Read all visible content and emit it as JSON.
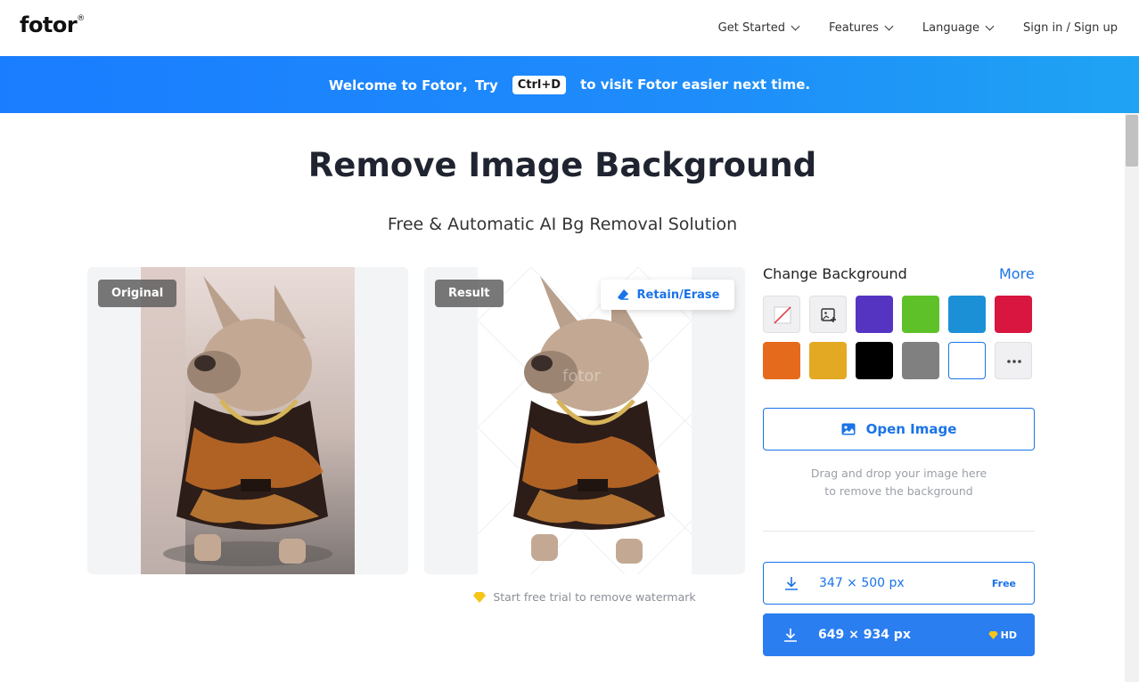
{
  "header": {
    "logo": "fotor",
    "logo_mark": "®",
    "nav": [
      {
        "label": "Get Started"
      },
      {
        "label": "Features"
      },
      {
        "label": "Language"
      }
    ],
    "auth_label": "Sign in / Sign up"
  },
  "banner": {
    "text_before": "Welcome to Fotor，Try",
    "shortcut": "Ctrl+D",
    "text_after": "to visit Fotor easier next time."
  },
  "page": {
    "title": "Remove Image Background",
    "subtitle": "Free & Automatic AI Bg Removal Solution"
  },
  "preview": {
    "original_tag": "Original",
    "result_tag": "Result",
    "retain_erase_label": "Retain/Erase",
    "watermark_note": "Start free trial to remove watermark"
  },
  "change_background": {
    "title": "Change Background",
    "more_label": "More",
    "swatches": [
      {
        "name": "none",
        "color": "#f0f0f2",
        "icon": "no-color-icon"
      },
      {
        "name": "custom-image",
        "color": "#f0f0f2",
        "icon": "image-plus-icon"
      },
      {
        "name": "purple",
        "color": "#5534c2"
      },
      {
        "name": "green",
        "color": "#5fc12a"
      },
      {
        "name": "blue",
        "color": "#1c90d6"
      },
      {
        "name": "red",
        "color": "#d8163f"
      },
      {
        "name": "orange",
        "color": "#e66a1b"
      },
      {
        "name": "yellow",
        "color": "#e4a922"
      },
      {
        "name": "black",
        "color": "#000000"
      },
      {
        "name": "gray",
        "color": "#808080"
      },
      {
        "name": "white",
        "color": "#ffffff",
        "selected": true
      },
      {
        "name": "more-colors",
        "color": "#f0f0f2",
        "icon": "more-dots-icon"
      }
    ]
  },
  "upload": {
    "open_label": "Open Image",
    "drag_line1": "Drag and drop your image here",
    "drag_line2": "to remove the background"
  },
  "downloads": [
    {
      "size": "347 × 500 px",
      "badge": "Free"
    },
    {
      "size": "649 × 934 px",
      "badge": "HD"
    }
  ],
  "colors": {
    "accent": "#1a73e8",
    "banner_start": "#1a7dff",
    "banner_end": "#1fa3f3"
  }
}
